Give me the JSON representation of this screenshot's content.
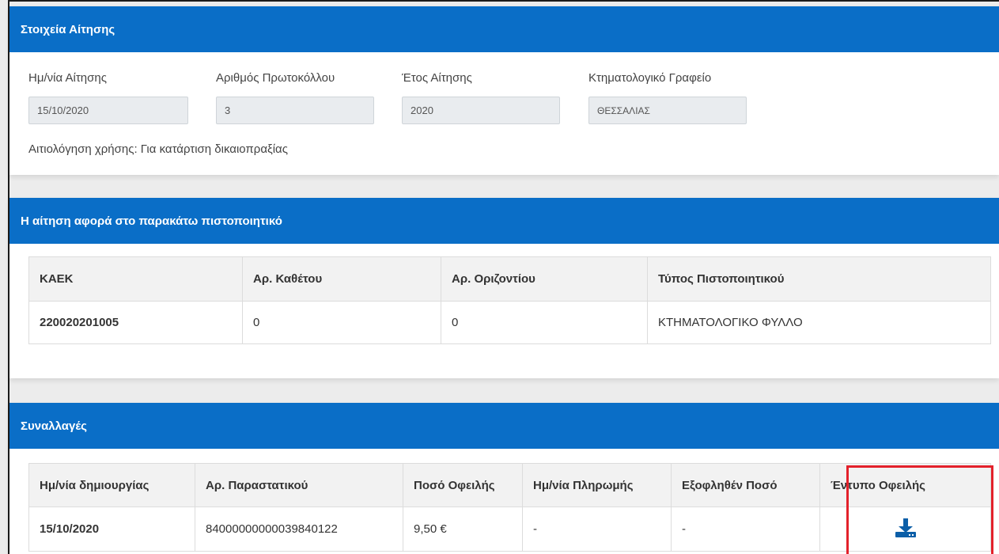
{
  "application": {
    "header": "Στοιχεία Αίτησης",
    "fields": [
      {
        "label": "Ημ/νία Αίτησης",
        "value": "15/10/2020"
      },
      {
        "label": "Αριθμός Πρωτοκόλλου",
        "value": "3"
      },
      {
        "label": "Έτος Αίτησης",
        "value": "2020"
      },
      {
        "label": "Κτηματολογικό Γραφείο",
        "value": "ΘΕΣΣΑΛΙΑΣ"
      }
    ],
    "reason": "Αιτιολόγηση χρήσης: Για κατάρτιση δικαιοπραξίας"
  },
  "certificate": {
    "header": "Η αίτηση αφορά στο παρακάτω πιστοποιητικό",
    "columns": [
      "ΚΑΕΚ",
      "Αρ. Καθέτου",
      "Αρ. Οριζοντίου",
      "Τύπος Πιστοποιητικού"
    ],
    "rows": [
      [
        "220020201005",
        "0",
        "0",
        "ΚΤΗΜΑΤΟΛΟΓΙΚΟ ΦΥΛΛΟ"
      ]
    ]
  },
  "transactions": {
    "header": "Συναλλαγές",
    "columns": [
      "Ημ/νία δημιουργίας",
      "Αρ. Παραστατικού",
      "Ποσό Οφειλής",
      "Ημ/νία Πληρωμής",
      "Εξοφληθέν Ποσό",
      "Έντυπο Οφειλής"
    ],
    "rows": [
      [
        "15/10/2020",
        "84000000000039840122",
        "9,50 €",
        "-",
        "-"
      ]
    ],
    "download_icon": "download-icon"
  },
  "colors": {
    "header_blue": "#0a6ec7",
    "highlight_red": "#e3212b",
    "icon_blue": "#0c5fa8"
  }
}
